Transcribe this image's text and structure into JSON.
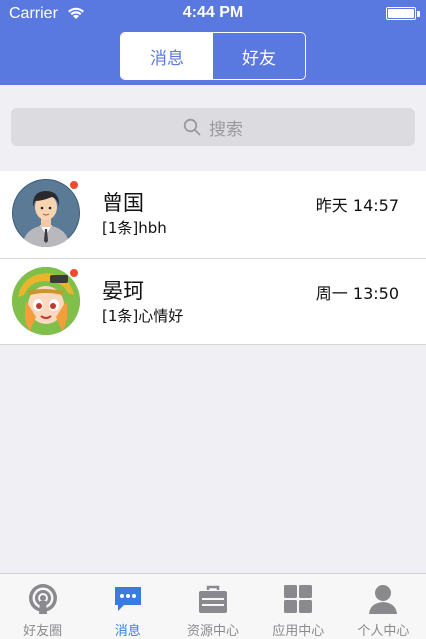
{
  "status_bar": {
    "carrier": "Carrier",
    "time": "4:44 PM"
  },
  "segmented": {
    "tabs": [
      {
        "label": "消息",
        "active": true
      },
      {
        "label": "好友",
        "active": false
      }
    ]
  },
  "search": {
    "placeholder": "搜索"
  },
  "conversations": [
    {
      "name": "曾国",
      "message": "[1条]hbh",
      "time": "昨天 14:57",
      "unread": true
    },
    {
      "name": "晏珂",
      "message": "[1条]心情好",
      "time": "周一 13:50",
      "unread": true
    }
  ],
  "tabbar": {
    "items": [
      {
        "label": "好友圈",
        "icon": "radar-icon",
        "active": false
      },
      {
        "label": "消息",
        "icon": "chat-bubble-icon",
        "active": true
      },
      {
        "label": "资源中心",
        "icon": "briefcase-icon",
        "active": false
      },
      {
        "label": "应用中心",
        "icon": "grid-icon",
        "active": false
      },
      {
        "label": "个人中心",
        "icon": "person-icon",
        "active": false
      }
    ]
  },
  "colors": {
    "header": "#5a79e0",
    "active_tab": "#3a7be0",
    "unread_dot": "#f04a2c"
  }
}
